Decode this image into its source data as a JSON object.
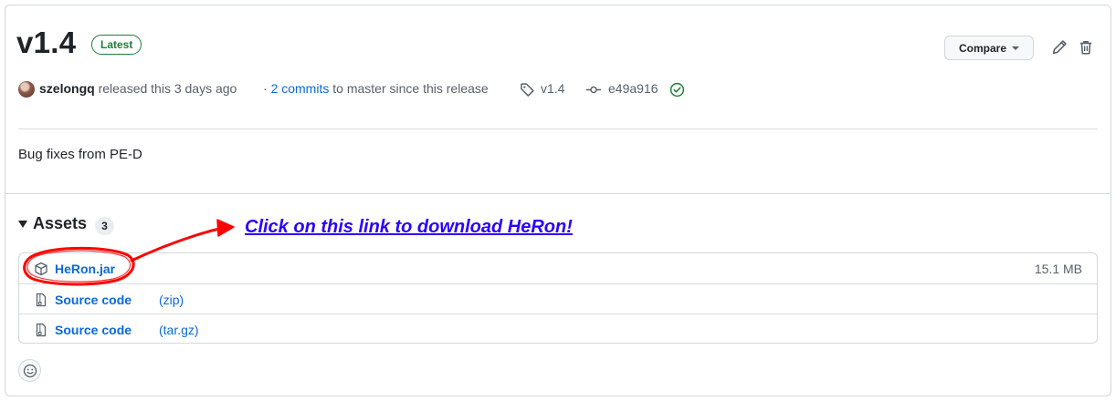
{
  "release": {
    "title": "v1.4",
    "badge": "Latest",
    "compare_label": "Compare",
    "author": "szelongq",
    "released_text": "released this 3 days ago",
    "commits_prefix": "·",
    "commits_link": "2 commits",
    "commits_suffix": "to master since this release",
    "tag": "v1.4",
    "commit_hash": "e49a916",
    "body": "Bug fixes from PE-D"
  },
  "assets": {
    "heading": "Assets",
    "count": "3",
    "items": [
      {
        "name": "HeRon.jar",
        "ext": "",
        "size": "15.1 MB",
        "icon": "package-icon"
      },
      {
        "name": "Source code",
        "ext": "(zip)",
        "size": "",
        "icon": "file-zip-icon"
      },
      {
        "name": "Source code",
        "ext": "(tar.gz)",
        "size": "",
        "icon": "file-zip-icon"
      }
    ]
  },
  "annotation": {
    "text": "Click on this link to download HeRon!",
    "color": "#2a00ff",
    "marker_color": "#ff0000"
  },
  "colors": {
    "link": "#0969da",
    "success": "#1a7f37",
    "border": "#d0d7de"
  }
}
